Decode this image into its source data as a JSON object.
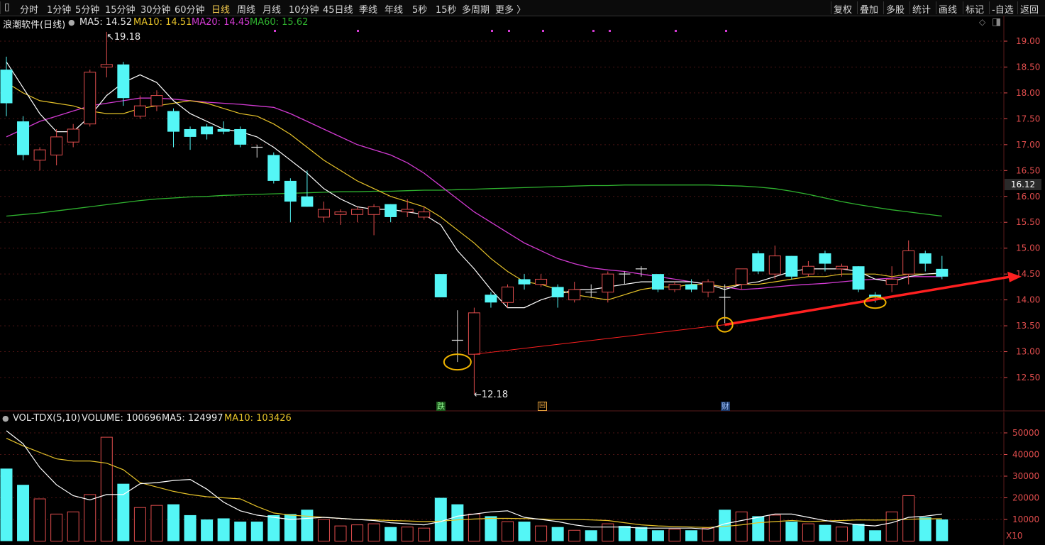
{
  "toolbar": {
    "timeframes": [
      "分时",
      "1分钟",
      "5分钟",
      "15分钟",
      "30分钟",
      "60分钟",
      "日线",
      "周线",
      "月线",
      "10分钟",
      "45日线",
      "季线",
      "年线",
      "5秒",
      "15秒",
      "多周期",
      "更多 〉"
    ],
    "active": "日线",
    "right_actions": [
      "复权",
      "叠加",
      "多股",
      "统计",
      "画线",
      "标记",
      "-自选",
      "返回"
    ]
  },
  "main_legend": {
    "title": "浪潮软件(日线)",
    "ma5": "MA5: 14.52",
    "ma10": "MA10: 14.51",
    "ma20": "MA20: 14.45",
    "ma60": "MA60: 15.62"
  },
  "vol_legend": {
    "title": "VOL-TDX(5,10)",
    "volume": "VOLUME: 100696",
    "ma5": "MA5: 124997",
    "ma10": "MA10: 103426"
  },
  "colors": {
    "up": "#e14d4d",
    "down": "#54f6f6",
    "ma5": "#ffffff",
    "ma10": "#e6c229",
    "ma20": "#d23ad2",
    "ma60": "#2fb32f",
    "trend": "#ff2020",
    "highlight": "#f0b400"
  },
  "annotations": {
    "high_label": "19.18",
    "low_label": "12.18",
    "current_price": "16.12",
    "marker_die": "跌",
    "marker_cai": "财",
    "vol_scale": "X10"
  },
  "chart_data": {
    "type": "candlestick",
    "price_axis": {
      "ticks": [
        "19.00",
        "18.50",
        "18.00",
        "17.50",
        "17.00",
        "16.50",
        "16.00",
        "15.50",
        "15.00",
        "14.50",
        "14.00",
        "13.50",
        "13.00",
        "12.50"
      ],
      "range": [
        12.0,
        19.5
      ]
    },
    "volume_axis": {
      "ticks": [
        "50000",
        "40000",
        "30000",
        "20000",
        "10000"
      ],
      "range": [
        0,
        55000
      ]
    },
    "candles": [
      [
        18.45,
        17.8,
        18.7,
        17.55
      ],
      [
        17.45,
        16.8,
        17.55,
        16.7
      ],
      [
        16.7,
        16.9,
        16.95,
        16.5
      ],
      [
        16.8,
        17.15,
        17.3,
        16.6
      ],
      [
        17.05,
        17.3,
        17.4,
        16.95
      ],
      [
        17.4,
        18.4,
        18.45,
        17.35
      ],
      [
        18.5,
        18.55,
        19.18,
        18.3
      ],
      [
        18.55,
        17.9,
        18.6,
        17.75
      ],
      [
        17.55,
        17.75,
        17.95,
        17.5
      ],
      [
        17.75,
        17.95,
        18.05,
        17.65
      ],
      [
        17.65,
        17.25,
        17.7,
        16.95
      ],
      [
        17.3,
        17.15,
        17.35,
        16.9
      ],
      [
        17.35,
        17.2,
        17.4,
        17.1
      ],
      [
        17.3,
        17.25,
        17.45,
        17.2
      ],
      [
        17.3,
        17.0,
        17.35,
        16.95
      ],
      [
        16.95,
        16.95,
        17.0,
        16.75
      ],
      [
        16.8,
        16.3,
        16.85,
        16.25
      ],
      [
        16.3,
        15.9,
        16.35,
        15.5
      ],
      [
        16.0,
        15.8,
        16.5,
        15.8
      ],
      [
        15.6,
        15.75,
        15.9,
        15.5
      ],
      [
        15.65,
        15.7,
        15.75,
        15.45
      ],
      [
        15.65,
        15.75,
        15.8,
        15.5
      ],
      [
        15.65,
        15.8,
        15.85,
        15.25
      ],
      [
        15.85,
        15.6,
        15.85,
        15.5
      ],
      [
        15.7,
        15.75,
        15.95,
        15.6
      ],
      [
        15.6,
        15.7,
        15.8,
        15.55
      ],
      [
        14.5,
        14.05,
        14.5,
        14.05
      ],
      [
        13.22,
        13.22,
        13.8,
        12.8
      ],
      [
        12.95,
        13.75,
        13.85,
        12.18
      ],
      [
        14.1,
        13.95,
        14.15,
        13.85
      ],
      [
        13.95,
        14.25,
        14.3,
        13.85
      ],
      [
        14.4,
        14.3,
        14.5,
        14.2
      ],
      [
        14.3,
        14.4,
        14.5,
        14.25
      ],
      [
        14.25,
        14.05,
        14.3,
        13.85
      ],
      [
        14.0,
        14.2,
        14.35,
        13.95
      ],
      [
        14.15,
        14.15,
        14.3,
        14.05
      ],
      [
        14.15,
        14.5,
        14.55,
        13.95
      ],
      [
        14.5,
        14.5,
        14.55,
        14.3
      ],
      [
        14.6,
        14.6,
        14.65,
        14.45
      ],
      [
        14.5,
        14.2,
        14.5,
        14.15
      ],
      [
        14.2,
        14.3,
        14.35,
        14.15
      ],
      [
        14.3,
        14.2,
        14.4,
        14.15
      ],
      [
        14.15,
        14.35,
        14.4,
        14.05
      ],
      [
        14.05,
        14.05,
        14.3,
        13.55
      ],
      [
        14.3,
        14.6,
        14.6,
        14.2
      ],
      [
        14.9,
        14.55,
        14.95,
        14.5
      ],
      [
        14.5,
        14.85,
        15.05,
        14.4
      ],
      [
        14.85,
        14.45,
        14.85,
        14.4
      ],
      [
        14.5,
        14.65,
        14.75,
        14.45
      ],
      [
        14.9,
        14.7,
        14.95,
        14.55
      ],
      [
        14.6,
        14.65,
        14.7,
        14.45
      ],
      [
        14.65,
        14.2,
        14.65,
        14.15
      ],
      [
        14.1,
        14.05,
        14.15,
        13.95
      ],
      [
        14.3,
        14.4,
        14.65,
        14.15
      ],
      [
        14.5,
        14.95,
        15.15,
        14.3
      ],
      [
        14.9,
        14.7,
        14.95,
        14.55
      ],
      [
        14.6,
        14.45,
        14.85,
        14.4
      ]
    ],
    "volume": [
      33500,
      26000,
      19500,
      12500,
      13500,
      21500,
      48000,
      26500,
      15500,
      16500,
      17000,
      12000,
      10000,
      10500,
      9000,
      9000,
      12000,
      12500,
      14500,
      10000,
      7000,
      7500,
      8000,
      6500,
      6500,
      6000,
      20000,
      17000,
      12500,
      11500,
      9000,
      9000,
      7000,
      6500,
      5000,
      5000,
      8000,
      7000,
      6500,
      5000,
      5500,
      5000,
      6000,
      14500,
      13500,
      11500,
      12000,
      9000,
      8000,
      7500,
      6500,
      8000,
      5000,
      13500,
      21000,
      11000,
      10000
    ],
    "ma5": [
      18.6,
      18.1,
      17.6,
      17.25,
      17.25,
      17.55,
      17.95,
      18.2,
      18.35,
      18.2,
      17.85,
      17.6,
      17.45,
      17.3,
      17.25,
      17.15,
      16.95,
      16.7,
      16.45,
      16.15,
      15.95,
      15.8,
      15.75,
      15.75,
      15.7,
      15.65,
      15.45,
      14.95,
      14.6,
      14.2,
      13.85,
      13.85,
      14.0,
      14.1,
      14.2,
      14.2,
      14.25,
      14.3,
      14.35,
      14.35,
      14.35,
      14.35,
      14.3,
      14.2,
      14.3,
      14.35,
      14.45,
      14.55,
      14.6,
      14.6,
      14.6,
      14.55,
      14.4,
      14.35,
      14.45,
      14.5,
      14.52
    ],
    "ma10": [
      18.2,
      18.0,
      17.85,
      17.8,
      17.75,
      17.65,
      17.6,
      17.6,
      17.7,
      17.75,
      17.8,
      17.85,
      17.8,
      17.7,
      17.6,
      17.55,
      17.4,
      17.2,
      16.95,
      16.7,
      16.5,
      16.3,
      16.15,
      16.0,
      15.9,
      15.8,
      15.6,
      15.35,
      15.1,
      14.8,
      14.55,
      14.35,
      14.3,
      14.2,
      14.1,
      14.05,
      14.0,
      14.1,
      14.2,
      14.25,
      14.25,
      14.3,
      14.3,
      14.25,
      14.3,
      14.3,
      14.35,
      14.4,
      14.45,
      14.45,
      14.5,
      14.5,
      14.5,
      14.45,
      14.5,
      14.5,
      14.51
    ],
    "ma20": [
      17.15,
      17.3,
      17.45,
      17.55,
      17.65,
      17.75,
      17.8,
      17.85,
      17.9,
      17.9,
      17.88,
      17.85,
      17.82,
      17.8,
      17.78,
      17.75,
      17.72,
      17.6,
      17.45,
      17.3,
      17.15,
      17.0,
      16.9,
      16.8,
      16.65,
      16.45,
      16.2,
      15.95,
      15.7,
      15.5,
      15.3,
      15.1,
      14.95,
      14.8,
      14.7,
      14.62,
      14.58,
      14.55,
      14.5,
      14.45,
      14.4,
      14.35,
      14.3,
      14.25,
      14.2,
      14.22,
      14.25,
      14.28,
      14.3,
      14.32,
      14.35,
      14.38,
      14.4,
      14.42,
      14.45,
      14.45,
      14.45
    ],
    "ma60": [
      15.62,
      15.65,
      15.68,
      15.72,
      15.76,
      15.8,
      15.84,
      15.88,
      15.92,
      15.95,
      15.97,
      15.99,
      16.0,
      16.02,
      16.03,
      16.04,
      16.05,
      16.06,
      16.07,
      16.08,
      16.09,
      16.09,
      16.1,
      16.1,
      16.11,
      16.12,
      16.12,
      16.13,
      16.14,
      16.15,
      16.16,
      16.17,
      16.18,
      16.19,
      16.2,
      16.21,
      16.21,
      16.22,
      16.22,
      16.22,
      16.22,
      16.22,
      16.22,
      16.21,
      16.2,
      16.18,
      16.15,
      16.1,
      16.04,
      15.97,
      15.9,
      15.84,
      15.79,
      15.74,
      15.7,
      15.66,
      15.62
    ],
    "vol_ma5": [
      51000,
      45000,
      34000,
      26000,
      21000,
      19000,
      21500,
      21500,
      26500,
      27000,
      28000,
      28500,
      24000,
      18000,
      14000,
      12000,
      11000,
      10000,
      10500,
      11000,
      10500,
      10000,
      9500,
      8500,
      8000,
      7500,
      9000,
      11500,
      12500,
      13500,
      14000,
      11000,
      10000,
      9000,
      7500,
      6500,
      6500,
      6500,
      6000,
      6000,
      6000,
      6000,
      5500,
      8000,
      9500,
      11000,
      12500,
      12500,
      11000,
      9500,
      8500,
      7500,
      7000,
      8500,
      11000,
      11500,
      12500
    ],
    "vol_ma10": [
      47500,
      44000,
      41000,
      38000,
      37000,
      37000,
      36000,
      33000,
      27000,
      25000,
      23000,
      21500,
      20500,
      20000,
      19500,
      16000,
      13000,
      12000,
      11500,
      11000,
      10500,
      10000,
      9800,
      9500,
      9300,
      9000,
      9200,
      9800,
      10200,
      10500,
      10500,
      10400,
      10200,
      10000,
      10000,
      9800,
      9500,
      8500,
      7500,
      7000,
      6800,
      6500,
      6300,
      6800,
      7500,
      8500,
      9000,
      9500,
      9000,
      9300,
      9500,
      9800,
      9700,
      9800,
      10100,
      10300,
      10343
    ]
  }
}
